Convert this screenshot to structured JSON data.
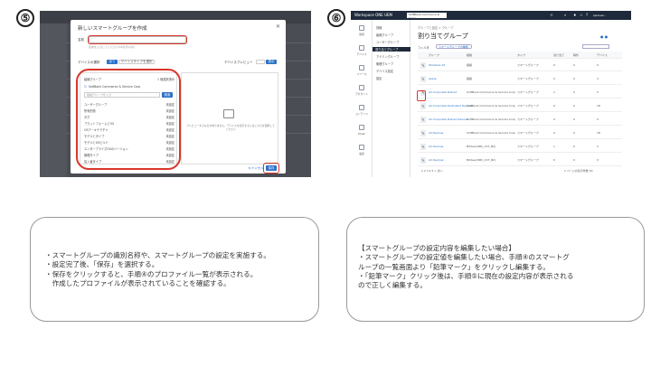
{
  "steps": {
    "left": "⑤",
    "right": "⑥"
  },
  "left_shot": {
    "title": "新しいスマートグループを作成",
    "name_label": "名前",
    "name_hint": "名前を入力してください(50文字以内)",
    "type_label": "デバイスの選択",
    "type_tab_all": "全て",
    "type_tab_specific": "デバイスタイプを選択",
    "preview_label": "デバイスプレビュー",
    "preview_btn": "表示",
    "org_header": "組織グループ",
    "org_count": "1 個選択済み",
    "org_item": "SoftBank Commerce & Service Corp",
    "search_placeholder": "組織グループを入力",
    "search_btn": "検索",
    "criteria": [
      {
        "label": "ユーザーグループ",
        "status": "未設定"
      },
      {
        "label": "所有形態",
        "status": "未設定"
      },
      {
        "label": "タグ",
        "status": "未設定"
      },
      {
        "label": "プラットフォームとOS",
        "status": "未設定"
      },
      {
        "label": "OSアーキテクチャ",
        "status": "未設定"
      },
      {
        "label": "モデルとタイプ",
        "status": "未設定"
      },
      {
        "label": "モデルとOSビルド",
        "status": "未設定"
      },
      {
        "label": "エンタープライズOSのバージョン",
        "status": "未設定"
      },
      {
        "label": "管理タイプ",
        "status": "未設定"
      },
      {
        "label": "加入者タイプ",
        "status": "未設定"
      }
    ],
    "preview_text": "プレビューするものがありません。デバイスを表示するにはこちらを選択してください",
    "cancel_btn": "キャンセル",
    "save_btn": "保存"
  },
  "right_shot": {
    "app_title": "Workspace ONE UEM",
    "org_dropdown": "SoftBank Commerce & Servi...",
    "top_icons": [
      "add-icon",
      "search-icon",
      "notification-icon",
      "star-icon",
      "help-icon"
    ],
    "user_label": "spnuser...",
    "sidebar": [
      "監視",
      "デバイス",
      "リソース",
      "アカウント",
      "コンテンツ",
      "Email",
      "電話"
    ],
    "nav": [
      {
        "label": "詳細"
      },
      {
        "label": "組織グループ"
      },
      {
        "label": "ユーザーグループ"
      },
      {
        "label": "割り当てグループ",
        "selected": true
      },
      {
        "label": "アドミングループ"
      },
      {
        "label": "管理グループ"
      },
      {
        "label": "デバイス設定"
      },
      {
        "label": "設定"
      }
    ],
    "breadcrumb": "グループと設定 > グループ",
    "page_title": "割り当てグループ",
    "filter_label": "フィルタ",
    "filter_chip": "スマートグループの種類",
    "columns": [
      "グループ",
      "組織",
      "タイプ",
      "割り当て",
      "除外",
      "デバイス"
    ],
    "rows": [
      {
        "group": "Windows 10",
        "org": "組織",
        "type": "スマートグループ",
        "a": "0",
        "e": "0",
        "d": "0"
      },
      {
        "group": "Apple",
        "org": "組織",
        "type": "スマートグループ",
        "a": "0",
        "e": "0",
        "d": "3"
      },
      {
        "group": "All Corporate Shared",
        "org": "SoftBank Commerce & Service Corp",
        "type": "スマートグループ",
        "a": "1",
        "e": "0",
        "d": "0"
      },
      {
        "group": "All Corporate Dedicated Devices",
        "org": "SoftBank Commerce & Service Corp",
        "type": "スマートグループ",
        "a": "0",
        "e": "0",
        "d": "18"
      },
      {
        "group": "All Corporate Shared Devices",
        "org": "SoftBank Commerce & Service Corp",
        "type": "スマートグループ",
        "a": "0",
        "e": "0",
        "d": "0"
      },
      {
        "group": "All Devices",
        "org": "SoftBank Commerce & Service Corp",
        "type": "スマートグループ",
        "a": "0",
        "e": "0",
        "d": "18"
      },
      {
        "group": "All Devices",
        "org": "Bitdeer(SBC_CCT_B2)",
        "type": "スマートグループ",
        "a": "1",
        "e": "0",
        "d": "3"
      },
      {
        "group": "All Devices",
        "org": "Bitdeer(SBC_CCT_B2)",
        "type": "スマートグループ",
        "a": "0",
        "e": "0",
        "d": "0"
      }
    ],
    "pagination": "1 2 3 4 5 > 次へ",
    "items_count": "1 ページの表示件数 50"
  },
  "notes": {
    "left": [
      "・スマートグループの識別名称や、スマートグループの設定を実施する。",
      "・設定完了後、「保存」を選択する。",
      "・保存をクリックすると、手順④のプロファイル一覧が表示される。",
      "　作成したプロファイルが表示されていることを確認する。"
    ],
    "right": [
      "【スマートグループの設定内容を編集したい場合】",
      "・スマートグループの設定値を編集したい場合、手順④のスマートグ",
      "ループの一覧画面より「鉛筆マーク」をクリックし編集する。",
      "・「鉛筆マーク」クリック後は、手順⑤に現在の設定内容が表示される",
      "ので正しく編集する。"
    ]
  }
}
